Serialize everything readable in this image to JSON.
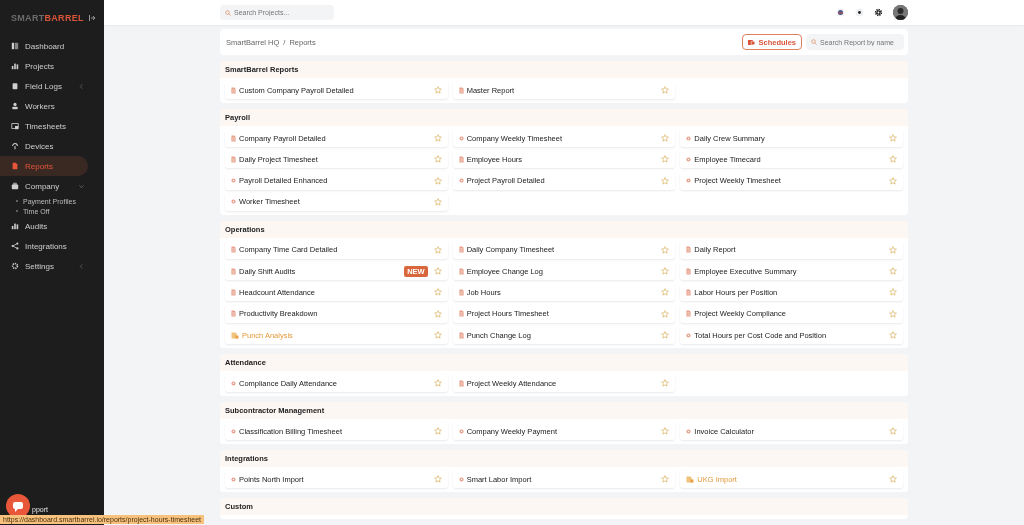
{
  "logo": {
    "light": "SMART",
    "accent": "BARREL"
  },
  "sidebar": {
    "items": [
      {
        "label": "Dashboard",
        "selected": false
      },
      {
        "label": "Projects",
        "selected": false
      },
      {
        "label": "Field Logs",
        "selected": false,
        "expanded": false
      },
      {
        "label": "Workers",
        "selected": false
      },
      {
        "label": "Timesheets",
        "selected": false
      },
      {
        "label": "Devices",
        "selected": false
      },
      {
        "label": "Reports",
        "selected": true
      },
      {
        "label": "Company",
        "selected": false,
        "expanded": true,
        "children": [
          {
            "label": "Payment Profiles"
          },
          {
            "label": "Time Off"
          }
        ]
      },
      {
        "label": "Audits",
        "selected": false
      },
      {
        "label": "Integrations",
        "selected": false
      },
      {
        "label": "Settings",
        "selected": false,
        "expanded": false
      }
    ]
  },
  "topbar": {
    "search": {
      "placeholder": "Search Projects..."
    }
  },
  "breadcrumb": [
    "SmartBarrel HQ",
    "/",
    "Reports"
  ],
  "schedules_button": "Schedules",
  "report_search": {
    "placeholder": "Search Report by name"
  },
  "sections": [
    {
      "title": "SmartBarrel Reports",
      "reports": [
        {
          "name": "Custom Company Payroll Detailed",
          "kind": "file"
        },
        {
          "name": "Master Report",
          "kind": "file"
        }
      ]
    },
    {
      "title": "Payroll",
      "reports": [
        {
          "name": "Company Payroll Detailed",
          "kind": "file"
        },
        {
          "name": "Company Weekly Timesheet",
          "kind": "round"
        },
        {
          "name": "Daily Crew Summary",
          "kind": "round"
        },
        {
          "name": "Daily Project Timesheet",
          "kind": "file"
        },
        {
          "name": "Employee Hours",
          "kind": "file"
        },
        {
          "name": "Employee Timecard",
          "kind": "round"
        },
        {
          "name": "Payroll Detailed Enhanced",
          "kind": "round"
        },
        {
          "name": "Project Payroll Detailed",
          "kind": "round"
        },
        {
          "name": "Project Weekly Timesheet",
          "kind": "round"
        },
        {
          "name": "Worker Timesheet",
          "kind": "round"
        }
      ]
    },
    {
      "title": "Operations",
      "reports": [
        {
          "name": "Company Time Card Detailed",
          "kind": "file"
        },
        {
          "name": "Daily Company Timesheet",
          "kind": "file"
        },
        {
          "name": "Daily Report",
          "kind": "file"
        },
        {
          "name": "Daily Shift Audits",
          "kind": "file",
          "badge": "NEW"
        },
        {
          "name": "Employee Change Log",
          "kind": "file"
        },
        {
          "name": "Employee Executive Summary",
          "kind": "file"
        },
        {
          "name": "Headcount Attendance",
          "kind": "file"
        },
        {
          "name": "Job Hours",
          "kind": "file"
        },
        {
          "name": "Labor Hours per Position",
          "kind": "file"
        },
        {
          "name": "Productivity Breakdown",
          "kind": "file"
        },
        {
          "name": "Project Hours Timesheet",
          "kind": "file"
        },
        {
          "name": "Project Weekly Compliance",
          "kind": "file"
        },
        {
          "name": "Punch Analysis",
          "kind": "chart"
        },
        {
          "name": "Punch Change Log",
          "kind": "file"
        },
        {
          "name": "Total Hours per Cost Code and Position",
          "kind": "round"
        }
      ]
    },
    {
      "title": "Attendance",
      "reports": [
        {
          "name": "Compliance Daily Attendance",
          "kind": "round"
        },
        {
          "name": "Project Weekly Attendance",
          "kind": "file"
        }
      ]
    },
    {
      "title": "Subcontractor Management",
      "reports": [
        {
          "name": "Classification Billing Timesheet",
          "kind": "round"
        },
        {
          "name": "Company Weekly Payment",
          "kind": "round"
        },
        {
          "name": "Invoice Calculator",
          "kind": "round"
        }
      ]
    },
    {
      "title": "Integrations",
      "reports": [
        {
          "name": "Points North Import",
          "kind": "round"
        },
        {
          "name": "Smart Labor Import",
          "kind": "round"
        },
        {
          "name": "UKG Import",
          "kind": "chart"
        }
      ]
    },
    {
      "title": "Custom"
    }
  ],
  "support_label": "pport",
  "status_url": "https://dashboard.smartbarrel.io/reports/project-hours-timesheet"
}
